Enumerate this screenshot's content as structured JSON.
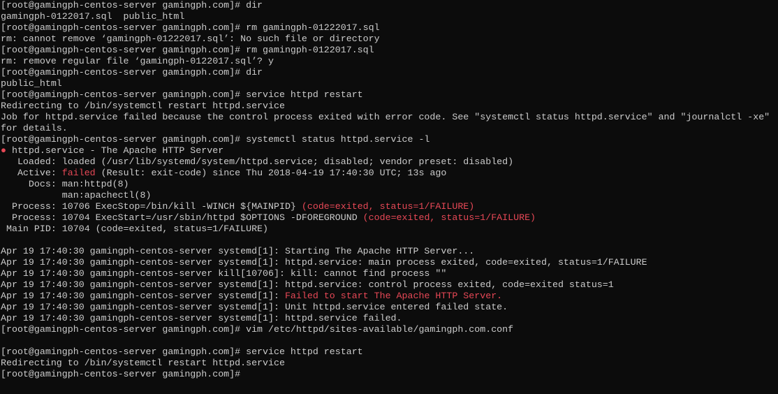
{
  "colors": {
    "background": "#0c0c0c",
    "text": "#cccccc",
    "error": "#e74856"
  },
  "lines": [
    [
      {
        "t": "[root@gamingph-centos-server gamingph.com]# dir"
      }
    ],
    [
      {
        "t": "gamingph-0122017.sql  public_html"
      }
    ],
    [
      {
        "t": "[root@gamingph-centos-server gamingph.com]# rm gamingph-01222017.sql"
      }
    ],
    [
      {
        "t": "rm: cannot remove ‘gamingph-01222017.sql’: No such file or directory"
      }
    ],
    [
      {
        "t": "[root@gamingph-centos-server gamingph.com]# rm gamingph-0122017.sql"
      }
    ],
    [
      {
        "t": "rm: remove regular file ‘gamingph-0122017.sql’? y"
      }
    ],
    [
      {
        "t": "[root@gamingph-centos-server gamingph.com]# dir"
      }
    ],
    [
      {
        "t": "public_html"
      }
    ],
    [
      {
        "t": "[root@gamingph-centos-server gamingph.com]# service httpd restart"
      }
    ],
    [
      {
        "t": "Redirecting to /bin/systemctl restart httpd.service"
      }
    ],
    [
      {
        "t": "Job for httpd.service failed because the control process exited with error code. See \"systemctl status httpd.service\" and \"journalctl -xe\""
      }
    ],
    [
      {
        "t": "for details."
      }
    ],
    [
      {
        "t": "[root@gamingph-centos-server gamingph.com]# systemctl status httpd.service -l"
      }
    ],
    [
      {
        "t": "●",
        "red": true
      },
      {
        "t": " httpd.service - The Apache HTTP Server"
      }
    ],
    [
      {
        "t": "   Loaded: loaded (/usr/lib/systemd/system/httpd.service; disabled; vendor preset: disabled)"
      }
    ],
    [
      {
        "t": "   Active: "
      },
      {
        "t": "failed",
        "red": true
      },
      {
        "t": " (Result: exit-code) since Thu 2018-04-19 17:40:30 UTC; 13s ago"
      }
    ],
    [
      {
        "t": "     Docs: man:httpd(8)"
      }
    ],
    [
      {
        "t": "           man:apachectl(8)"
      }
    ],
    [
      {
        "t": "  Process: 10706 ExecStop=/bin/kill -WINCH ${MAINPID} "
      },
      {
        "t": "(code=exited, status=1/FAILURE)",
        "red": true
      }
    ],
    [
      {
        "t": "  Process: 10704 ExecStart=/usr/sbin/httpd $OPTIONS -DFOREGROUND "
      },
      {
        "t": "(code=exited, status=1/FAILURE)",
        "red": true
      }
    ],
    [
      {
        "t": " Main PID: 10704 (code=exited, status=1/FAILURE)"
      }
    ],
    [
      {
        "t": ""
      }
    ],
    [
      {
        "t": "Apr 19 17:40:30 gamingph-centos-server systemd[1]: Starting The Apache HTTP Server..."
      }
    ],
    [
      {
        "t": "Apr 19 17:40:30 gamingph-centos-server systemd[1]: httpd.service: main process exited, code=exited, status=1/FAILURE"
      }
    ],
    [
      {
        "t": "Apr 19 17:40:30 gamingph-centos-server kill[10706]: kill: cannot find process \"\""
      }
    ],
    [
      {
        "t": "Apr 19 17:40:30 gamingph-centos-server systemd[1]: httpd.service: control process exited, code=exited status=1"
      }
    ],
    [
      {
        "t": "Apr 19 17:40:30 gamingph-centos-server systemd[1]: "
      },
      {
        "t": "Failed to start The Apache HTTP Server.",
        "red": true
      }
    ],
    [
      {
        "t": "Apr 19 17:40:30 gamingph-centos-server systemd[1]: Unit httpd.service entered failed state."
      }
    ],
    [
      {
        "t": "Apr 19 17:40:30 gamingph-centos-server systemd[1]: httpd.service failed."
      }
    ],
    [
      {
        "t": "[root@gamingph-centos-server gamingph.com]# vim /etc/httpd/sites-available/gamingph.com.conf"
      }
    ],
    [
      {
        "t": ""
      }
    ],
    [
      {
        "t": "[root@gamingph-centos-server gamingph.com]# service httpd restart"
      }
    ],
    [
      {
        "t": "Redirecting to /bin/systemctl restart httpd.service"
      }
    ],
    [
      {
        "t": "[root@gamingph-centos-server gamingph.com]#"
      }
    ]
  ]
}
